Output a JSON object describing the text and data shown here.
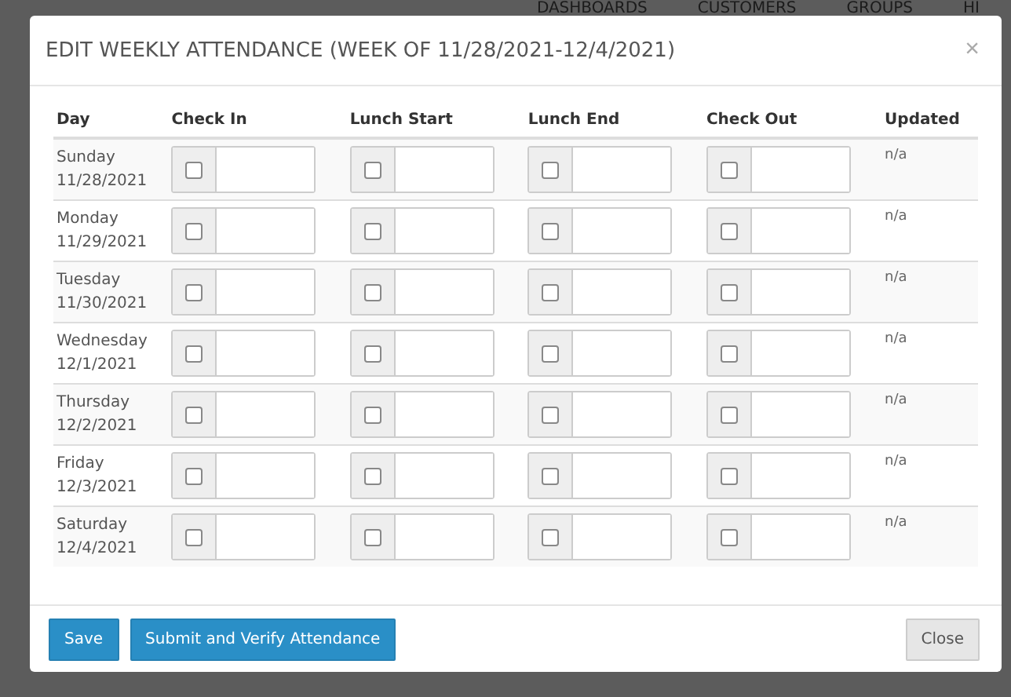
{
  "background_nav": [
    "DASHBOARDS",
    "CUSTOMERS",
    "GROUPS",
    "HI"
  ],
  "modal": {
    "title": "EDIT WEEKLY ATTENDANCE (WEEK OF 11/28/2021-12/4/2021)",
    "close": "×"
  },
  "table": {
    "columns": [
      "Day",
      "Check In",
      "Lunch Start",
      "Lunch End",
      "Check Out",
      "Updated"
    ],
    "rows": [
      {
        "day": "Sunday",
        "date": "11/28/2021",
        "checks": [
          false,
          false,
          false,
          false
        ],
        "updated": "n/a"
      },
      {
        "day": "Monday",
        "date": "11/29/2021",
        "checks": [
          false,
          false,
          false,
          false
        ],
        "updated": "n/a"
      },
      {
        "day": "Tuesday",
        "date": "11/30/2021",
        "checks": [
          false,
          false,
          false,
          false
        ],
        "updated": "n/a"
      },
      {
        "day": "Wednesday",
        "date": "12/1/2021",
        "checks": [
          false,
          false,
          false,
          false
        ],
        "updated": "n/a"
      },
      {
        "day": "Thursday",
        "date": "12/2/2021",
        "checks": [
          false,
          false,
          false,
          false
        ],
        "updated": "n/a"
      },
      {
        "day": "Friday",
        "date": "12/3/2021",
        "checks": [
          false,
          false,
          false,
          false
        ],
        "updated": "n/a"
      },
      {
        "day": "Saturday",
        "date": "12/4/2021",
        "checks": [
          false,
          false,
          false,
          false
        ],
        "updated": "n/a"
      }
    ]
  },
  "buttons": [
    {
      "label": "Save",
      "kind": "primary"
    },
    {
      "label": "Submit and Verify Attendance",
      "kind": "primary"
    },
    {
      "label": "Close",
      "kind": "default"
    }
  ]
}
